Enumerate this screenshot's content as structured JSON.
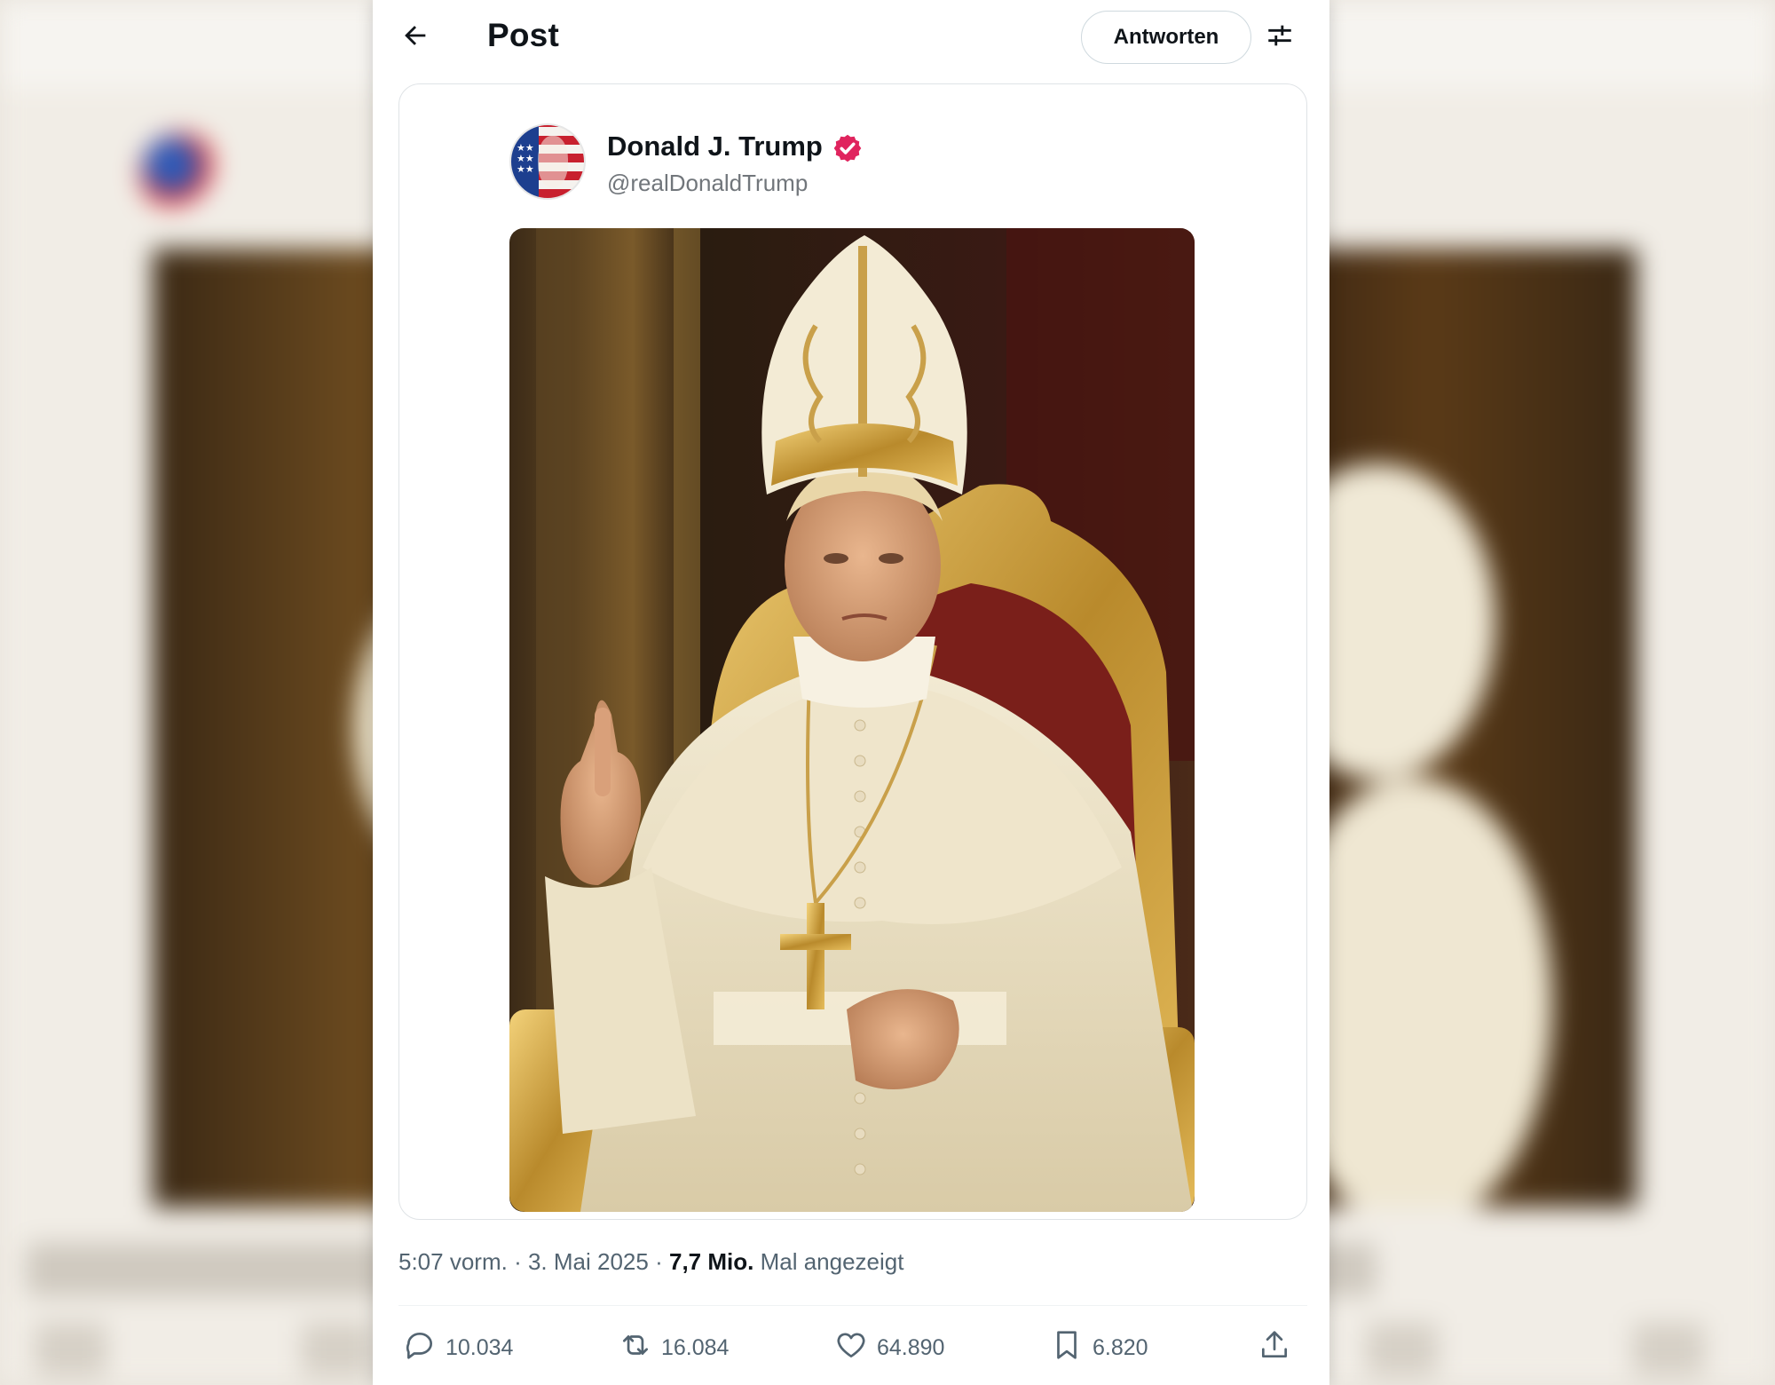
{
  "header": {
    "title": "Post",
    "reply_button": "Antworten",
    "back_icon": "arrow-left-icon",
    "settings_icon": "sliders-icon"
  },
  "post": {
    "author_name": "Donald J. Trump",
    "author_handle": "@realDonaldTrump",
    "verified_color": "#e0245e",
    "image_description_icon": "photo"
  },
  "meta": {
    "time": "5:07 vorm.",
    "separator": "·",
    "date": "3. Mai 2025",
    "views_count": "7,7 Mio.",
    "views_label": "Mal angezeigt"
  },
  "actions": {
    "replies": "10.034",
    "reposts": "16.084",
    "likes": "64.890",
    "bookmarks": "6.820"
  },
  "colors": {
    "text_primary": "#0f1419",
    "text_secondary": "#536471",
    "border": "#cfd9de"
  }
}
